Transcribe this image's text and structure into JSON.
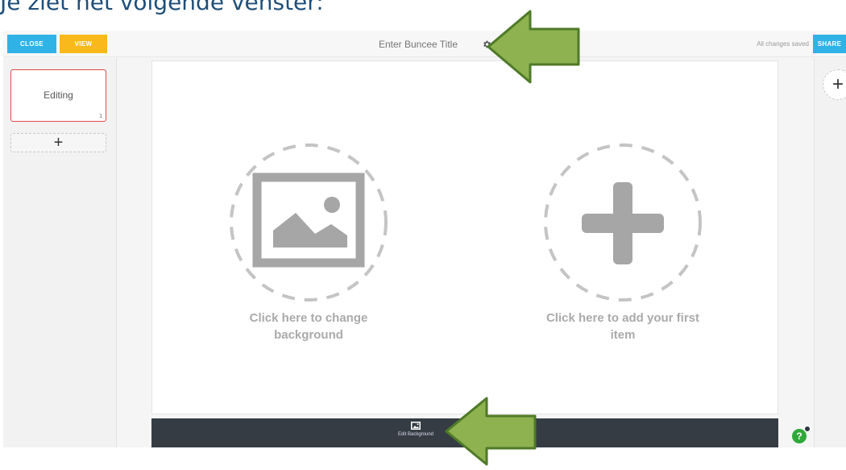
{
  "caption": "Je ziet het volgende venster:",
  "topbar": {
    "close_label": "CLOSE",
    "view_label": "VIEW",
    "title_placeholder": "Enter Buncee Title",
    "status": "All changes saved",
    "share_label": "SHARE"
  },
  "slides": {
    "items": [
      {
        "label": "Editing",
        "number": "1"
      }
    ],
    "add_label": "+"
  },
  "canvas": {
    "background_prompt": "Click here to change background",
    "add_item_prompt": "Click here to add your first item"
  },
  "bottom_bar": {
    "edit_background_label": "Edit Background"
  },
  "right_panel": {
    "add_label": "+"
  },
  "help": {
    "label": "?"
  },
  "colors": {
    "accent_blue": "#2fb3e6",
    "accent_yellow": "#f9b91a",
    "selected_red": "#e2474b",
    "bottom_bar": "#353c44",
    "arrow_green": "#8db24f",
    "help_green": "#2ea83a"
  }
}
